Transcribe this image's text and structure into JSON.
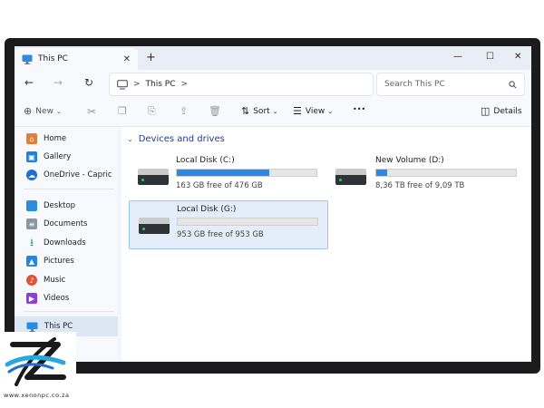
{
  "window": {
    "tab_title": "This PC",
    "new_tab": "+",
    "close_tab": "✕",
    "controls": {
      "minimize": "—",
      "maximize": "☐",
      "close": "✕"
    }
  },
  "nav": {
    "back": "←",
    "forward": "→",
    "refresh": "↻"
  },
  "address": {
    "separator": ">",
    "segment": "This PC",
    "trailing": ">"
  },
  "search": {
    "placeholder": "Search This PC"
  },
  "toolbar": {
    "new_label": "New",
    "sort_label": "Sort",
    "view_label": "View",
    "more_label": "•••",
    "details_label": "Details"
  },
  "sidebar": {
    "items": [
      {
        "label": "Home",
        "icon": "home-icon",
        "color": "#e0803a"
      },
      {
        "label": "Gallery",
        "icon": "gallery-icon",
        "color": "#1f83d8"
      },
      {
        "label": "OneDrive - Capric",
        "icon": "cloud-icon",
        "color": "#1f6fd0"
      },
      {
        "label": "Desktop",
        "icon": "desktop-icon",
        "color": "#2a8be0"
      },
      {
        "label": "Documents",
        "icon": "documents-icon",
        "color": "#8b95a5"
      },
      {
        "label": "Downloads",
        "icon": "download-icon",
        "color": "#1f9a4d"
      },
      {
        "label": "Pictures",
        "icon": "pictures-icon",
        "color": "#2a85e0"
      },
      {
        "label": "Music",
        "icon": "music-icon",
        "color": "#e0533a"
      },
      {
        "label": "Videos",
        "icon": "videos-icon",
        "color": "#8e3ed6"
      },
      {
        "label": "This PC",
        "icon": "pc-icon",
        "color": "#1f83d8"
      }
    ]
  },
  "content": {
    "group_title": "Devices and drives",
    "drives": [
      {
        "name": "Local Disk (C:)",
        "free_text": "163 GB free of 476 GB",
        "used_fraction": 0.66
      },
      {
        "name": "New Volume (D:)",
        "free_text": "8,36 TB free of 9,09 TB",
        "used_fraction": 0.08
      },
      {
        "name": "Local Disk (G:)",
        "free_text": "953 GB free of 953 GB",
        "used_fraction": 0.0
      }
    ]
  },
  "logo": {
    "url": "www.xenonpc.co.za"
  },
  "colors": {
    "accent": "#2b8ae6",
    "selection": "#e3eefa",
    "group_title": "#1f3b8f"
  }
}
